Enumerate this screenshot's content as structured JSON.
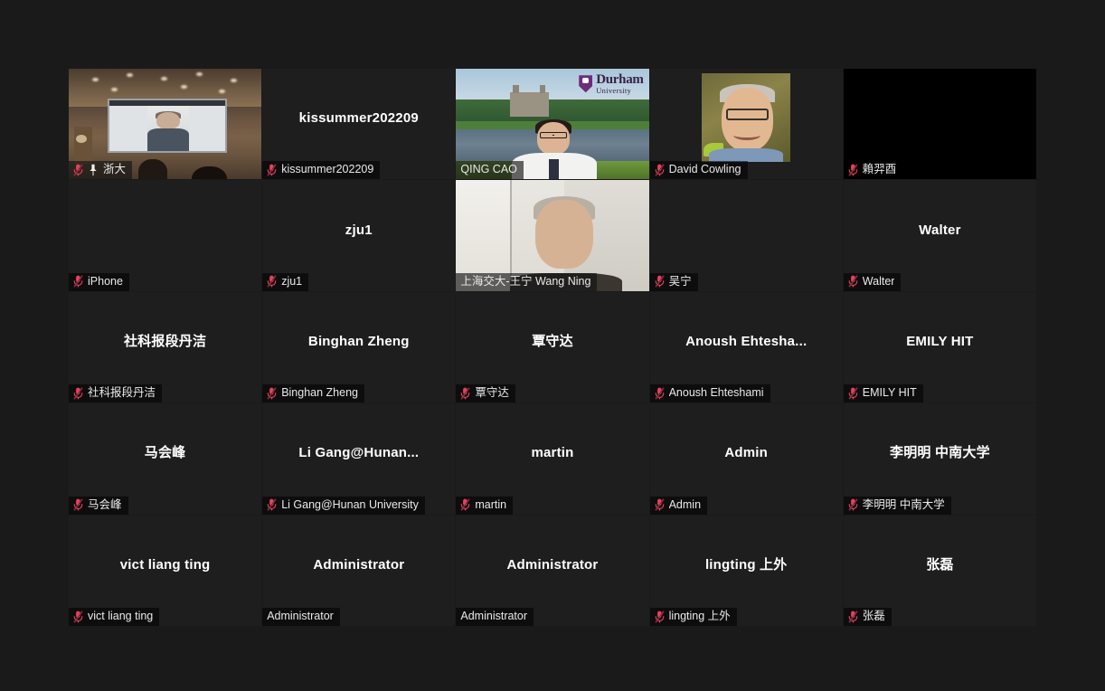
{
  "app": {
    "name": "Zoom Meeting",
    "view": "gallery-view",
    "background_color": "#1a1a1a",
    "active_speaker_border_color": "#8fe02a",
    "muted_icon_color": "#e8405a"
  },
  "grid": {
    "columns": 5,
    "rows": 5,
    "participant_count": 25
  },
  "participants": [
    {
      "label": "浙大",
      "center_name": "",
      "kind": "video",
      "video": "lecture-hall",
      "muted": true,
      "pinned": true,
      "active_speaker": false
    },
    {
      "label": "kissummer202209",
      "center_name": "kissummer202209",
      "kind": "name-only",
      "muted": true,
      "pinned": false,
      "active_speaker": false
    },
    {
      "label": "QING CAO",
      "center_name": "",
      "kind": "video",
      "video": "durham-university",
      "muted": false,
      "pinned": false,
      "active_speaker": false
    },
    {
      "label": "David Cowling",
      "center_name": "",
      "kind": "avatar",
      "muted": true,
      "pinned": false,
      "active_speaker": false
    },
    {
      "label": "賴羿酉",
      "center_name": "",
      "kind": "black-camera",
      "muted": true,
      "pinned": false,
      "active_speaker": false
    },
    {
      "label": "iPhone",
      "center_name": "",
      "kind": "name-only",
      "muted": true,
      "pinned": false,
      "active_speaker": false
    },
    {
      "label": "zju1",
      "center_name": "zju1",
      "kind": "name-only",
      "muted": true,
      "pinned": false,
      "active_speaker": false
    },
    {
      "label": "上海交大-王宁 Wang Ning",
      "center_name": "",
      "kind": "video",
      "video": "wang-ning",
      "muted": false,
      "pinned": false,
      "active_speaker": true
    },
    {
      "label": "吴宁",
      "center_name": "",
      "kind": "name-only",
      "muted": true,
      "pinned": false,
      "active_speaker": false
    },
    {
      "label": "Walter",
      "center_name": "Walter",
      "kind": "name-only",
      "muted": true,
      "pinned": false,
      "active_speaker": false
    },
    {
      "label": "社科报段丹洁",
      "center_name": "社科报段丹洁",
      "kind": "name-only",
      "muted": true,
      "pinned": false,
      "active_speaker": false
    },
    {
      "label": "Binghan Zheng",
      "center_name": "Binghan Zheng",
      "kind": "name-only",
      "muted": true,
      "pinned": false,
      "active_speaker": false
    },
    {
      "label": "覃守达",
      "center_name": "覃守达",
      "kind": "name-only",
      "muted": true,
      "pinned": false,
      "active_speaker": false
    },
    {
      "label": "Anoush Ehteshami",
      "center_name": "Anoush  Ehtesha...",
      "kind": "name-only",
      "muted": true,
      "pinned": false,
      "active_speaker": false
    },
    {
      "label": "EMILY  HIT",
      "center_name": "EMILY  HIT",
      "kind": "name-only",
      "muted": true,
      "pinned": false,
      "active_speaker": false
    },
    {
      "label": "马会峰",
      "center_name": "马会峰",
      "kind": "name-only",
      "muted": true,
      "pinned": false,
      "active_speaker": false
    },
    {
      "label": "Li Gang@Hunan University",
      "center_name": "Li  Gang@Hunan...",
      "kind": "name-only",
      "muted": true,
      "pinned": false,
      "active_speaker": false
    },
    {
      "label": "martin",
      "center_name": "martin",
      "kind": "name-only",
      "muted": true,
      "pinned": false,
      "active_speaker": false
    },
    {
      "label": "Admin",
      "center_name": "Admin",
      "kind": "name-only",
      "muted": true,
      "pinned": false,
      "active_speaker": false
    },
    {
      "label": "李明明 中南大学",
      "center_name": "李明明 中南大学",
      "kind": "name-only",
      "muted": true,
      "pinned": false,
      "active_speaker": false
    },
    {
      "label": "vict  liang ting",
      "center_name": "vict  liang ting",
      "kind": "name-only",
      "muted": true,
      "pinned": false,
      "active_speaker": false
    },
    {
      "label": "Administrator",
      "center_name": "Administrator",
      "kind": "name-only",
      "muted": false,
      "pinned": false,
      "active_speaker": false
    },
    {
      "label": "Administrator",
      "center_name": "Administrator",
      "kind": "name-only",
      "muted": false,
      "pinned": false,
      "active_speaker": false
    },
    {
      "label": "lingting 上外",
      "center_name": "lingting 上外",
      "kind": "name-only",
      "muted": true,
      "pinned": false,
      "active_speaker": false
    },
    {
      "label": "张磊",
      "center_name": "张磊",
      "kind": "name-only",
      "muted": true,
      "pinned": false,
      "active_speaker": false
    }
  ],
  "virtual_backgrounds": {
    "durham": {
      "org_line1": "Durham",
      "org_line2": "University"
    }
  }
}
